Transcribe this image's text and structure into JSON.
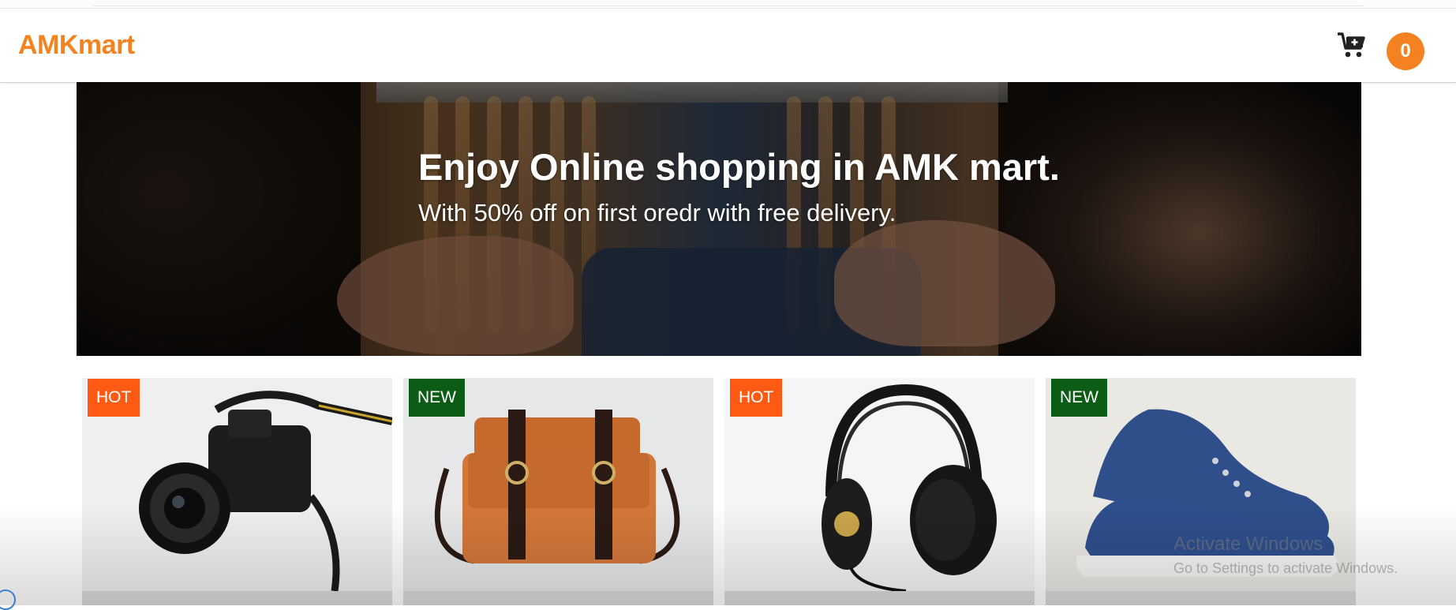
{
  "navbar": {
    "brand": "AMKmart",
    "cart_icon": "cart-plus-icon",
    "cart_count": "0"
  },
  "hero": {
    "title": "Enjoy Online shopping in AMK mart.",
    "subtitle": "With 50% off on first oredr with free delivery."
  },
  "products": [
    {
      "badge": "HOT",
      "image": "camera-icon"
    },
    {
      "badge": "NEW",
      "image": "bag-icon"
    },
    {
      "badge": "HOT",
      "image": "headphones-icon"
    },
    {
      "badge": "NEW",
      "image": "sneaker-icon"
    }
  ],
  "watermark": {
    "line1": "Activate Windows",
    "line2": "Go to Settings to activate Windows."
  },
  "colors": {
    "brand": "#f58220",
    "hot_badge": "#ff5a14",
    "new_badge": "#0d5c16",
    "selection": "#5b8fd8"
  }
}
